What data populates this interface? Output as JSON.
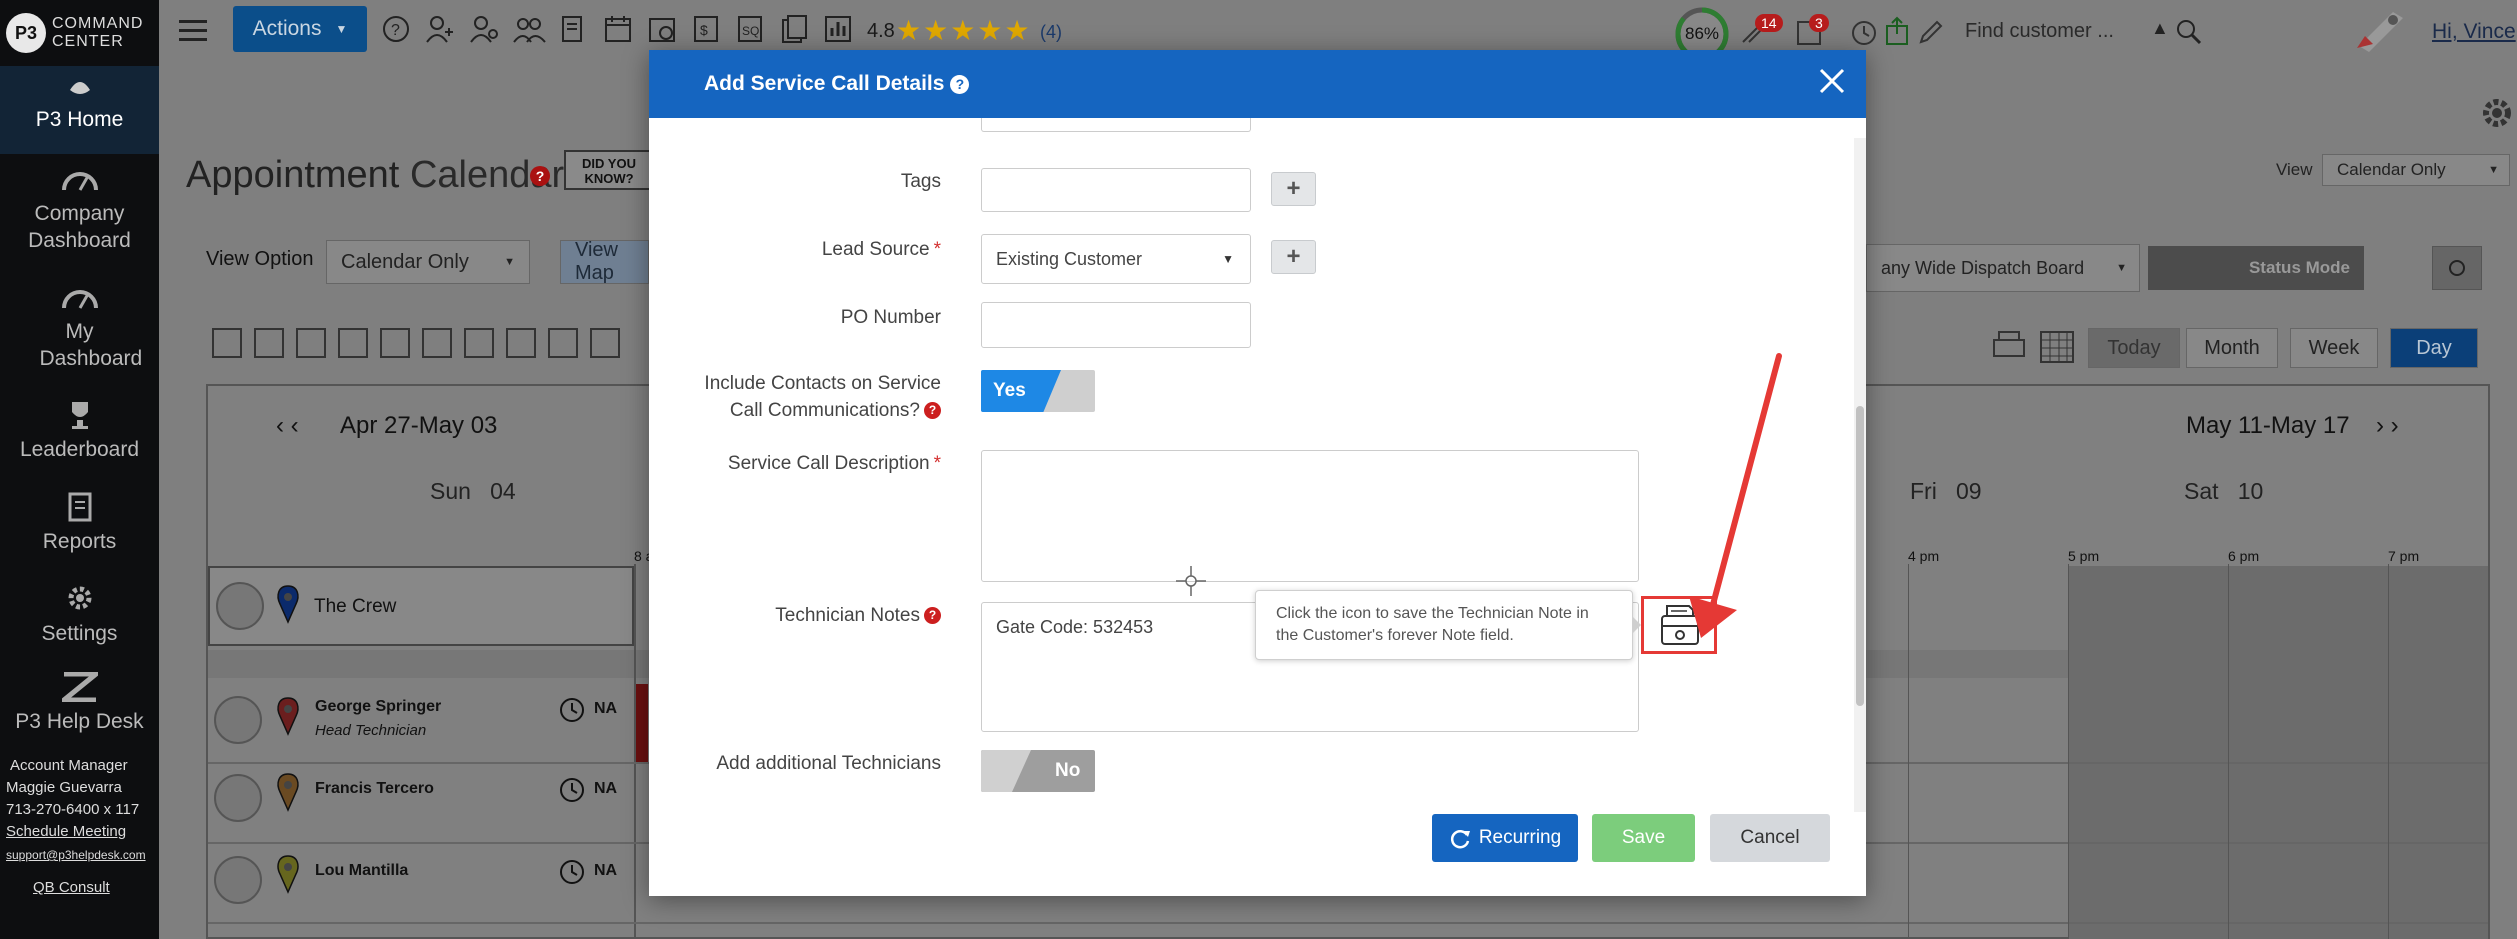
{
  "app": {
    "logo_badge": "P3",
    "logo_line1": "COMMAND",
    "logo_line2": "CENTER"
  },
  "sidebar": {
    "items": [
      {
        "label": "P3 Home",
        "icon": "home-icon"
      },
      {
        "label": "Company Dashboard",
        "icon": "gauge-icon"
      },
      {
        "label": "My Dashboard",
        "icon": "gauge-icon"
      },
      {
        "label": "Leaderboard",
        "icon": "trophy-icon"
      },
      {
        "label": "Reports",
        "icon": "report-icon"
      },
      {
        "label": "Settings",
        "icon": "gear-icon"
      },
      {
        "label": "P3 Help Desk",
        "icon": "zendesk-icon"
      }
    ],
    "account": {
      "title": "Account Manager",
      "name": "Maggie Guevarra",
      "phone": "713-270-6400 x 117",
      "schedule": "Schedule Meeting",
      "email": "support@p3helpdesk.com",
      "qb": "QB Consult"
    }
  },
  "topbar": {
    "actions_label": "Actions",
    "rating_value": "4.8",
    "rating_count": "(4)",
    "rating_stars": 5,
    "progress_label": "86%",
    "progress_value": 0.86,
    "badge_1": "14",
    "badge_2": "3",
    "search_placeholder": "Find customer ...",
    "greeting": "Hi, Vince"
  },
  "page": {
    "title_part1": "Appointment",
    "title_part2": "Calendar",
    "did_you_know": "DID YOU KNOW?",
    "view_label": "View",
    "view_value": "Calendar Only",
    "view_option_label": "View Option",
    "view_option_value": "Calendar Only",
    "view_map": "View Map",
    "dispatch_board": "any Wide Dispatch Board",
    "status_mode": "Status Mode",
    "today": "Today",
    "month": "Month",
    "week": "Week",
    "day": "Day",
    "range_left": "Apr 27-May 03",
    "range_right": "May 11-May 17",
    "days": [
      {
        "name": "Sun",
        "num": "04"
      },
      {
        "name": "Fri",
        "num": "09"
      },
      {
        "name": "Sat",
        "num": "10"
      }
    ],
    "hours": [
      "8 a",
      "4 pm",
      "5 pm",
      "6 pm",
      "7 pm"
    ],
    "crew": "The Crew",
    "techs": [
      {
        "name": "George Springer",
        "role": "Head Technician",
        "na": "NA",
        "pin": "#b33"
      },
      {
        "name": "Francis Tercero",
        "role": "",
        "na": "NA",
        "pin": "#a06a2c"
      },
      {
        "name": "Lou Mantilla",
        "role": "",
        "na": "NA",
        "pin": "#9a9a2c"
      }
    ]
  },
  "modal": {
    "title": "Add Service Call Details",
    "fields": {
      "tags_label": "Tags",
      "tags_value": "",
      "lead_source_label": "Lead Source",
      "lead_source_value": "Existing Customer",
      "po_label": "PO Number",
      "po_value": "",
      "contacts_label_1": "Include Contacts on Service",
      "contacts_label_2": "Call Communications?",
      "contacts_toggle": "Yes",
      "description_label": "Service Call Description",
      "description_value": "",
      "tech_notes_label": "Technician Notes",
      "tech_notes_value": "Gate Code: 532453",
      "add_tech_label": "Add additional Technicians",
      "add_tech_toggle": "No"
    },
    "tooltip": "Click the icon to save the Technician Note in the Customer's forever Note field.",
    "buttons": {
      "recurring": "Recurring",
      "save": "Save",
      "cancel": "Cancel"
    }
  },
  "colors": {
    "modal_header": "#1565c0",
    "primary_button": "#1565c0",
    "save_button": "#7ccd7c",
    "annotation_red": "#e53935",
    "sidebar_bg": "#0d0e10"
  }
}
